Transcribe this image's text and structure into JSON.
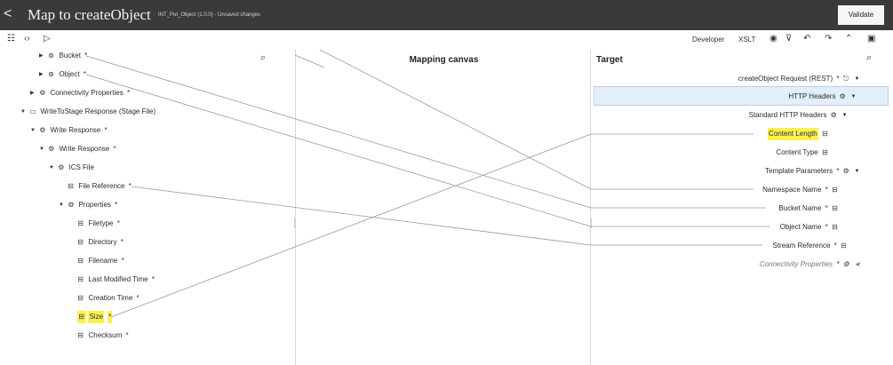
{
  "titlebar": {
    "back": "<",
    "title": "Map to createObject",
    "subtitle": "INT_Put_Object (1.0.0) - Unsaved changes",
    "validate": "Validate"
  },
  "toolbar": {
    "left_icons": [
      "list-icon",
      "code-icon",
      "play-icon"
    ],
    "developer": "Developer",
    "xslt": "XSLT",
    "right_icons": [
      "eye-icon",
      "filter-icon",
      "undo-icon",
      "redo-icon",
      "collapse-icon",
      "panel-icon"
    ]
  },
  "source": {
    "items": [
      {
        "label": "Bucket",
        "star": "*",
        "caret": "▶",
        "icon": "element-icon"
      },
      {
        "label": "Object",
        "star": "*",
        "caret": "▶",
        "icon": "element-icon"
      },
      {
        "label": "Connectivity Properties",
        "star": "*",
        "caret": "▶",
        "icon": "complex-icon"
      },
      {
        "label": "WriteToStage Response (Stage File)",
        "star": "",
        "caret": "▼",
        "icon": "document-icon"
      },
      {
        "label": "Write Response",
        "star": "*",
        "caret": "▼",
        "icon": "complex-icon"
      },
      {
        "label": "Write Response",
        "star": "*",
        "caret": "▼",
        "icon": "complex-icon"
      },
      {
        "label": "ICS File",
        "star": "",
        "caret": "▼",
        "icon": "complex-icon"
      },
      {
        "label": "File Reference",
        "star": "*",
        "caret": "",
        "icon": "field-icon"
      },
      {
        "label": "Properties",
        "star": "*",
        "caret": "▼",
        "icon": "complex-icon"
      },
      {
        "label": "Filetype",
        "star": "*",
        "caret": "",
        "icon": "field-icon"
      },
      {
        "label": "Directory",
        "star": "*",
        "caret": "",
        "icon": "field-icon"
      },
      {
        "label": "Filename",
        "star": "*",
        "caret": "",
        "icon": "field-icon"
      },
      {
        "label": "Last Modified Time",
        "star": "*",
        "caret": "",
        "icon": "field-icon"
      },
      {
        "label": "Creation Time",
        "star": "*",
        "caret": "",
        "icon": "field-icon"
      },
      {
        "label": "Size",
        "star": "*",
        "caret": "",
        "icon": "field-icon"
      },
      {
        "label": "Checksum",
        "star": "*",
        "caret": "",
        "icon": "field-icon"
      }
    ]
  },
  "canvas": {
    "title": "Mapping canvas"
  },
  "target": {
    "title": "Target",
    "items": [
      {
        "label": "createObject Request (REST)",
        "star": "*",
        "icon": "request-icon",
        "caret": "▼"
      },
      {
        "label": "HTTP Headers",
        "star": "",
        "icon": "complex-icon",
        "caret": "▼"
      },
      {
        "label": "Standard HTTP Headers",
        "star": "",
        "icon": "complex-icon",
        "caret": "▼"
      },
      {
        "label": "Content Length",
        "star": "",
        "icon": "field-icon",
        "caret": ""
      },
      {
        "label": "Content Type",
        "star": "",
        "icon": "field-icon",
        "caret": ""
      },
      {
        "label": "Template Parameters",
        "star": "*",
        "icon": "complex-icon",
        "caret": "▼"
      },
      {
        "label": "Namespace Name",
        "star": "*",
        "icon": "field-icon",
        "caret": ""
      },
      {
        "label": "Bucket Name",
        "star": "*",
        "icon": "field-icon",
        "caret": ""
      },
      {
        "label": "Object Name",
        "star": "*",
        "icon": "field-icon",
        "caret": ""
      },
      {
        "label": "Stream Reference",
        "star": "*",
        "icon": "field-icon",
        "caret": ""
      },
      {
        "label": "Connectivity Properties",
        "star": "*",
        "icon": "complex-icon",
        "caret": "◀"
      }
    ]
  },
  "colors": {
    "titlebar": "#3a3a3a",
    "highlight": "#fdf24a",
    "selected_row": "#e3eef8",
    "mapping_line": "#9a9a9a"
  }
}
